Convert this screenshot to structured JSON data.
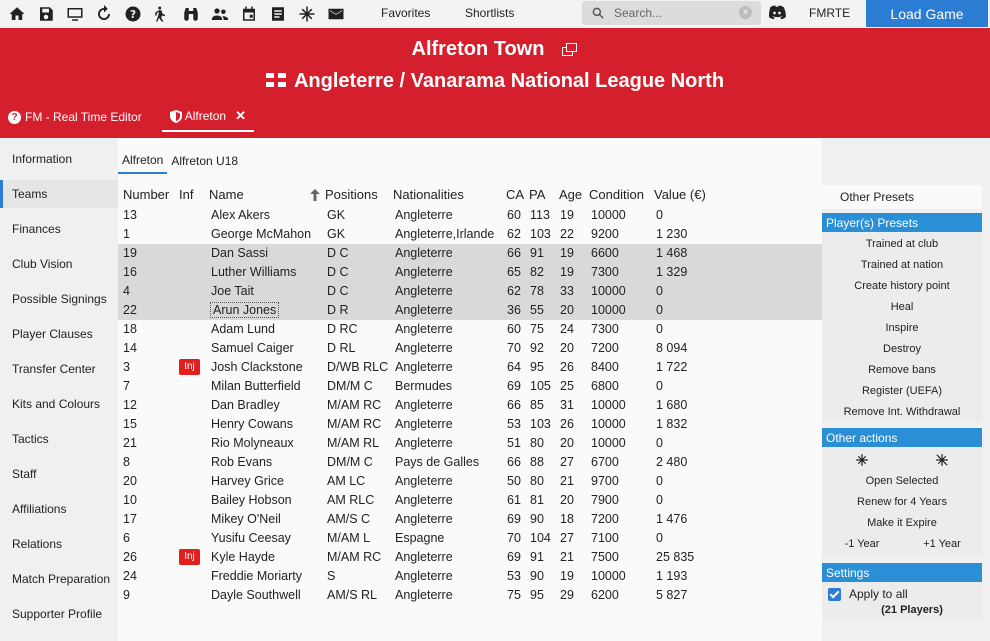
{
  "toolbar": {
    "icons": [
      "home-icon",
      "save-icon",
      "monitor-icon",
      "refresh-icon",
      "help-icon",
      "walk-icon",
      "binoculars-icon",
      "people-icon",
      "calendar-icon",
      "note-icon",
      "snowflake-icon",
      "mail-icon"
    ],
    "favorites": "Favorites",
    "shortlists": "Shortlists",
    "search_placeholder": "Search...",
    "fmrte": "FMRTE",
    "load_game": "Load Game"
  },
  "header": {
    "club": "Alfreton Town",
    "league": "Angleterre / Vanarama National League North",
    "tabs": [
      {
        "label": "FM - Real Time Editor"
      },
      {
        "label": "Alfreton"
      }
    ]
  },
  "sidebar": {
    "items": [
      "Information",
      "Teams",
      "Finances",
      "Club Vision",
      "Possible Signings",
      "Player Clauses",
      "Transfer Center",
      "Kits and Colours",
      "Tactics",
      "Staff",
      "Affiliations",
      "Relations",
      "Match Preparation",
      "Supporter Profile"
    ],
    "active": "Teams"
  },
  "subtabs": [
    "Alfreton",
    "Alfreton U18"
  ],
  "table": {
    "headers": {
      "number": "Number",
      "inf": "Inf",
      "name": "Name",
      "positions": "Positions",
      "nationalities": "Nationalities",
      "ca": "CA",
      "pa": "PA",
      "age": "Age",
      "condition": "Condition",
      "value": "Value (€)"
    },
    "rows": [
      {
        "number": "13",
        "inf": "",
        "name": "Alex Akers",
        "pos": "GK",
        "nat": "Angleterre",
        "ca": "60",
        "pa": "113",
        "age": "19",
        "cond": "10000",
        "value": "0",
        "sel": false
      },
      {
        "number": "1",
        "inf": "",
        "name": "George McMahon",
        "pos": "GK",
        "nat": "Angleterre,Irlande",
        "ca": "62",
        "pa": "103",
        "age": "22",
        "cond": "9200",
        "value": "1 230",
        "sel": false
      },
      {
        "number": "19",
        "inf": "",
        "name": "Dan Sassi",
        "pos": "D C",
        "nat": "Angleterre",
        "ca": "66",
        "pa": "91",
        "age": "19",
        "cond": "6600",
        "value": "1 468",
        "sel": true
      },
      {
        "number": "16",
        "inf": "",
        "name": "Luther Williams",
        "pos": "D C",
        "nat": "Angleterre",
        "ca": "65",
        "pa": "82",
        "age": "19",
        "cond": "7300",
        "value": "1 329",
        "sel": true
      },
      {
        "number": "4",
        "inf": "",
        "name": "Joe Tait",
        "pos": "D C",
        "nat": "Angleterre",
        "ca": "62",
        "pa": "78",
        "age": "33",
        "cond": "10000",
        "value": "0",
        "sel": true
      },
      {
        "number": "22",
        "inf": "",
        "name": "Arun Jones",
        "pos": "D R",
        "nat": "Angleterre",
        "ca": "36",
        "pa": "55",
        "age": "20",
        "cond": "10000",
        "value": "0",
        "sel": true,
        "focus": true
      },
      {
        "number": "18",
        "inf": "",
        "name": "Adam Lund",
        "pos": "D RC",
        "nat": "Angleterre",
        "ca": "60",
        "pa": "75",
        "age": "24",
        "cond": "7300",
        "value": "0",
        "sel": false
      },
      {
        "number": "14",
        "inf": "",
        "name": "Samuel Caiger",
        "pos": "D RL",
        "nat": "Angleterre",
        "ca": "70",
        "pa": "92",
        "age": "20",
        "cond": "7200",
        "value": "8 094",
        "sel": false
      },
      {
        "number": "3",
        "inf": "Inj",
        "name": "Josh Clackstone",
        "pos": "D/WB RLC",
        "nat": "Angleterre",
        "ca": "64",
        "pa": "95",
        "age": "26",
        "cond": "8400",
        "value": "1 722",
        "sel": false
      },
      {
        "number": "7",
        "inf": "",
        "name": "Milan Butterfield",
        "pos": "DM/M C",
        "nat": "Bermudes",
        "ca": "69",
        "pa": "105",
        "age": "25",
        "cond": "6800",
        "value": "0",
        "sel": false
      },
      {
        "number": "12",
        "inf": "",
        "name": "Dan Bradley",
        "pos": "M/AM RC",
        "nat": "Angleterre",
        "ca": "66",
        "pa": "85",
        "age": "31",
        "cond": "10000",
        "value": "1 680",
        "sel": false
      },
      {
        "number": "15",
        "inf": "",
        "name": "Henry Cowans",
        "pos": "M/AM RC",
        "nat": "Angleterre",
        "ca": "53",
        "pa": "103",
        "age": "26",
        "cond": "10000",
        "value": "1 832",
        "sel": false
      },
      {
        "number": "21",
        "inf": "",
        "name": "Rio Molyneaux",
        "pos": "M/AM RL",
        "nat": "Angleterre",
        "ca": "51",
        "pa": "80",
        "age": "20",
        "cond": "10000",
        "value": "0",
        "sel": false
      },
      {
        "number": "8",
        "inf": "",
        "name": "Rob Evans",
        "pos": "DM/M C",
        "nat": "Pays de Galles",
        "ca": "66",
        "pa": "88",
        "age": "27",
        "cond": "6700",
        "value": "2 480",
        "sel": false
      },
      {
        "number": "20",
        "inf": "",
        "name": "Harvey Grice",
        "pos": "AM LC",
        "nat": "Angleterre",
        "ca": "50",
        "pa": "80",
        "age": "21",
        "cond": "9700",
        "value": "0",
        "sel": false
      },
      {
        "number": "10",
        "inf": "",
        "name": "Bailey Hobson",
        "pos": "AM RLC",
        "nat": "Angleterre",
        "ca": "61",
        "pa": "81",
        "age": "20",
        "cond": "7900",
        "value": "0",
        "sel": false
      },
      {
        "number": "17",
        "inf": "",
        "name": "Mikey O'Neil",
        "pos": "AM/S C",
        "nat": "Angleterre",
        "ca": "69",
        "pa": "90",
        "age": "18",
        "cond": "7200",
        "value": "1 476",
        "sel": false
      },
      {
        "number": "6",
        "inf": "",
        "name": "Yusifu Ceesay",
        "pos": "M/AM L",
        "nat": "Espagne",
        "ca": "70",
        "pa": "104",
        "age": "27",
        "cond": "7100",
        "value": "0",
        "sel": false
      },
      {
        "number": "26",
        "inf": "Inj",
        "name": "Kyle Hayde",
        "pos": "M/AM RC",
        "nat": "Angleterre",
        "ca": "69",
        "pa": "91",
        "age": "21",
        "cond": "7500",
        "value": "25 835",
        "sel": false
      },
      {
        "number": "24",
        "inf": "",
        "name": "Freddie Moriarty",
        "pos": "S",
        "nat": "Angleterre",
        "ca": "53",
        "pa": "90",
        "age": "19",
        "cond": "10000",
        "value": "1 193",
        "sel": false
      },
      {
        "number": "9",
        "inf": "",
        "name": "Dayle Southwell",
        "pos": "AM/S RL",
        "nat": "Angleterre",
        "ca": "75",
        "pa": "95",
        "age": "29",
        "cond": "6200",
        "value": "5 827",
        "sel": false
      }
    ]
  },
  "right_panel": {
    "other_presets": "Other Presets",
    "player_presets_title": "Player(s) Presets",
    "player_presets": [
      "Trained at club",
      "Trained at nation",
      "Create history point",
      "Heal",
      "Inspire",
      "Destroy",
      "Remove bans",
      "Register (UEFA)",
      "Remove Int. Withdrawal"
    ],
    "other_actions_title": "Other actions",
    "open_selected": "Open Selected",
    "renew": "Renew for 4 Years",
    "expire": "Make it Expire",
    "minus_year": "-1 Year",
    "plus_year": "+1 Year",
    "settings_title": "Settings",
    "apply_all": "Apply to all",
    "players_count": "(21 Players)"
  }
}
